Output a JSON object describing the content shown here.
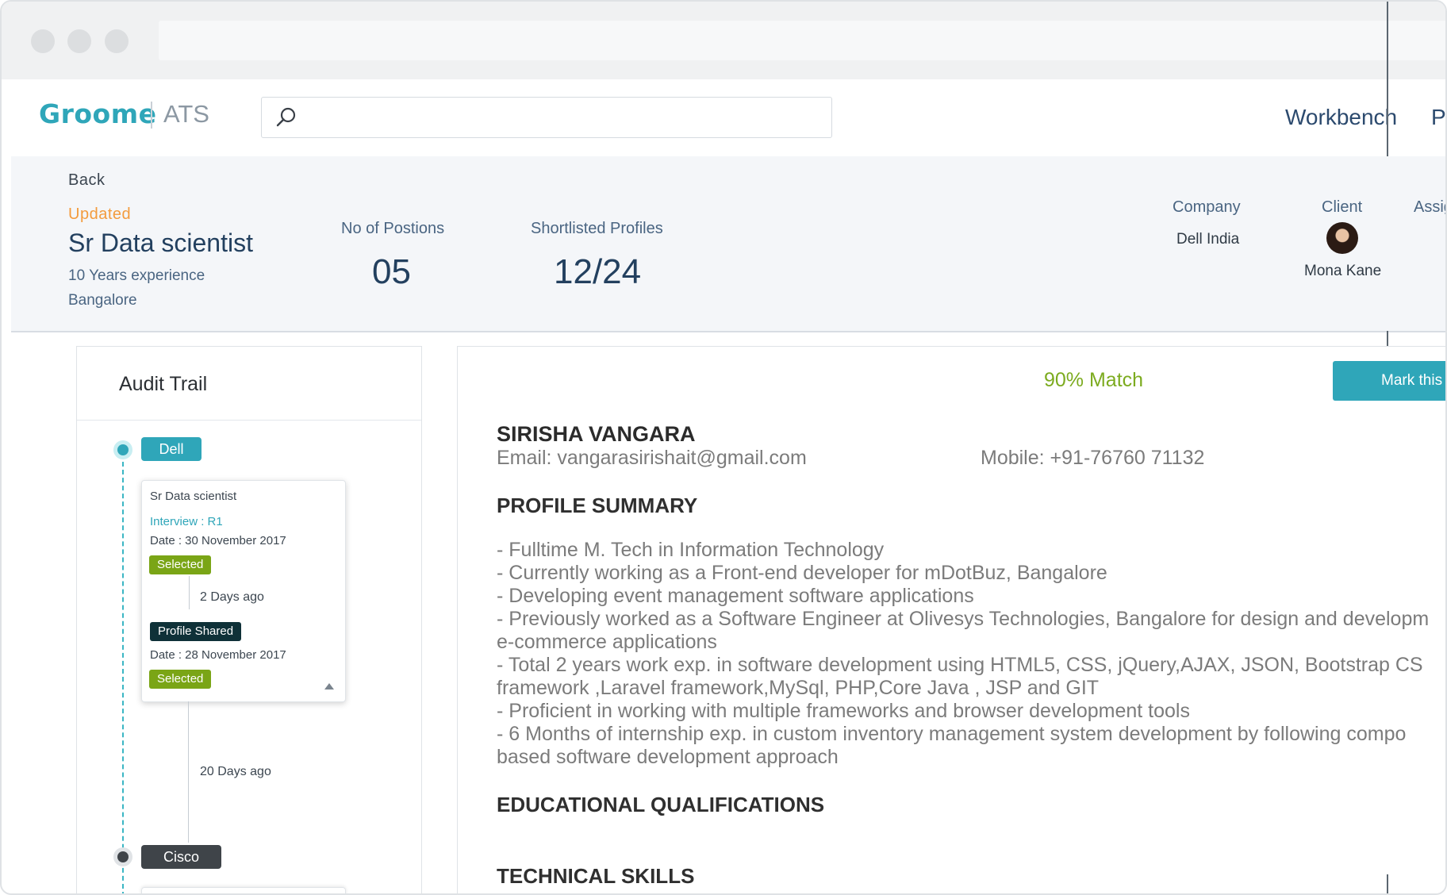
{
  "brand": {
    "name": "Groome",
    "product": "ATS",
    "color": "#2fa6b9"
  },
  "search": {
    "placeholder": ""
  },
  "nav": {
    "items": [
      {
        "label": "Workbench"
      },
      {
        "label": "Pr"
      }
    ]
  },
  "job": {
    "back_label": "Back",
    "status": "Updated",
    "title": "Sr Data scientist",
    "experience": "10 Years experience",
    "location": "Bangalore",
    "positions_label": "No of Postions",
    "positions_value": "05",
    "shortlisted_label": "Shortlisted Profiles",
    "shortlisted_value": "12/24",
    "company_label": "Company",
    "company_value": "Dell India",
    "client_label": "Client",
    "client_name": "Mona Kane",
    "assignee_label": "Assig"
  },
  "audit": {
    "title": "Audit Trail",
    "companies": [
      {
        "label": "Dell",
        "color": "#2fa6b9"
      },
      {
        "label": "Cisco",
        "color": "#3f4449"
      }
    ],
    "card": {
      "role": "Sr Data scientist",
      "interview": "Interview : R1",
      "date1": "Date : 30 November 2017",
      "badge1": "Selected",
      "ago1": "2 Days ago",
      "shared_badge": "Profile Shared",
      "date2": "Date : 28 November 2017",
      "badge2": "Selected"
    },
    "ago_outer": "20 Days ago",
    "colors": {
      "selected": "#7aa516",
      "shared": "#0f3138",
      "interview": "#2fa6b9"
    }
  },
  "resume": {
    "match": "90% Match",
    "mark_button": "Mark this",
    "name": "SIRISHA VANGARA",
    "email": "Email: vangarasirishait@gmail.com",
    "mobile": "Mobile: +91-76760 71132",
    "profile_heading": "PROFILE SUMMARY",
    "summary_lines": [
      "- Fulltime M. Tech in Information Technology",
      "- Currently working as a Front-end developer for mDotBuz, Bangalore",
      "- Developing event management software applications",
      "- Previously worked as a Software Engineer at Olivesys Technologies, Bangalore for design and developm",
      "e-commerce applications",
      "- Total 2 years work exp. in software development using HTML5, CSS, jQuery,AJAX, JSON, Bootstrap CS",
      "framework ,Laravel framework,MySql, PHP,Core  Java , JSP and GIT",
      "- Proficient in working with multiple frameworks and browser development tools",
      "- 6 Months of internship exp. in custom inventory management system development by following compo",
      "based software development approach"
    ],
    "education_heading": "EDUCATIONAL QUALIFICATIONS",
    "skills_heading": "TECHNICAL SKILLS"
  }
}
